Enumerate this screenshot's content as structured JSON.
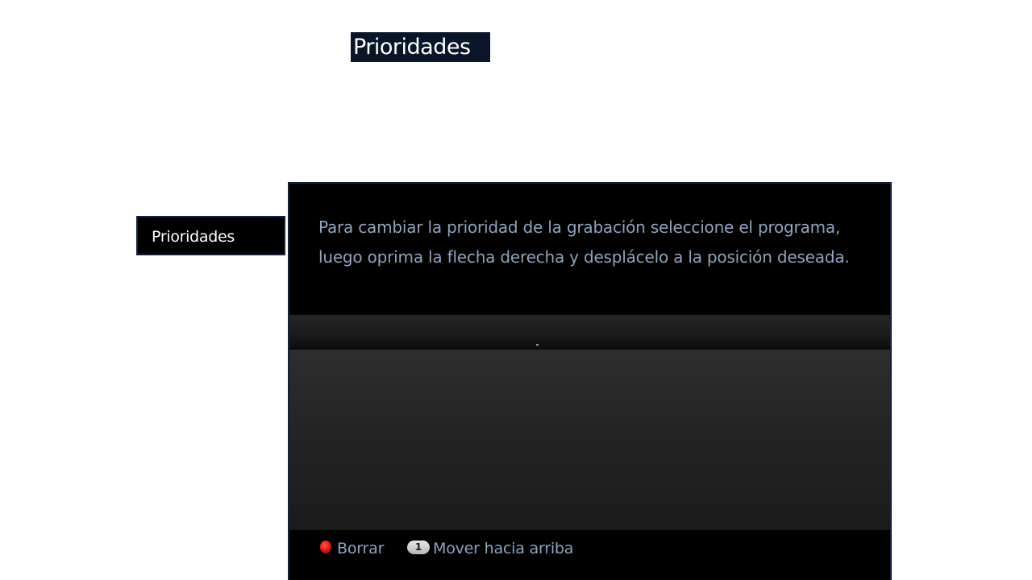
{
  "page": {
    "title": "Prioridades"
  },
  "sidebar": {
    "active_tab": "Prioridades"
  },
  "panel": {
    "instructions": "Para cambiar la prioridad de la grabación seleccione el programa, luego oprima la flecha derecha y desplácelo a la posición deseada.",
    "list_items": []
  },
  "footer": {
    "actions": [
      {
        "label": "Borrar",
        "icon": "red-button-icon",
        "color": "#e01010"
      },
      {
        "label": "Mover hacia arriba",
        "icon": "key-1-icon",
        "key_label": "1"
      }
    ]
  },
  "colors": {
    "title_background": "#0a1628",
    "panel_background": "#000000",
    "instruction_text": "#8fa4bd",
    "border_accent": "#0f2244"
  }
}
